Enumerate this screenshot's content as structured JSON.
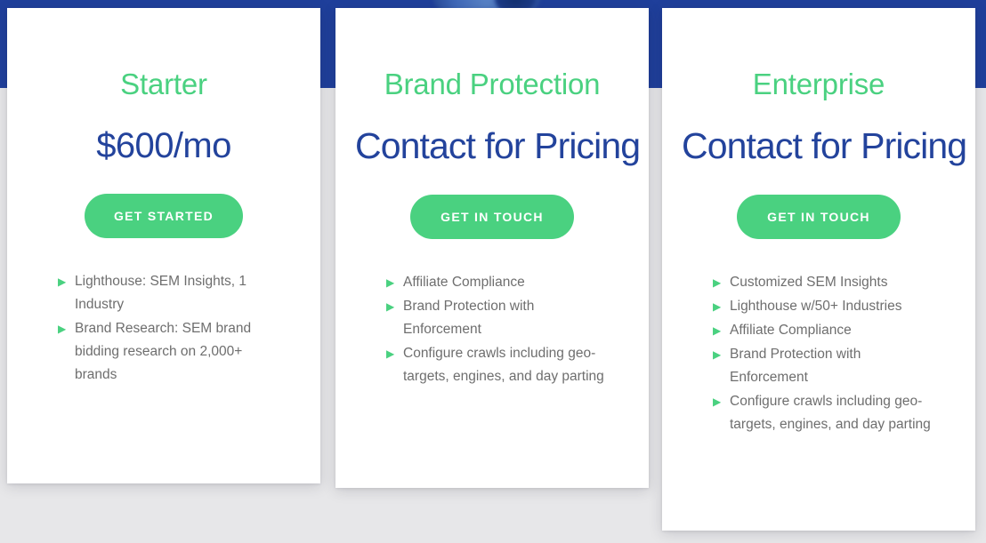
{
  "theme": {
    "band_color": "#1f3f9b",
    "page_background": "#e7e7e9",
    "card_background": "#ffffff",
    "accent_green": "#4ad180",
    "price_blue": "#23439c",
    "feature_text_color": "#6e6e6e",
    "bullet_glyph": "▶"
  },
  "plans": [
    {
      "name": "Starter",
      "price": "$600/mo",
      "cta_label": "GET STARTED",
      "features": [
        "Lighthouse: SEM Insights, 1 Industry",
        "Brand Research:  SEM brand bidding research on 2,000+ brands"
      ]
    },
    {
      "name": "Brand Protection",
      "price": "Contact for Pricing",
      "cta_label": "GET IN TOUCH",
      "features": [
        "Affiliate Compliance",
        "Brand Protection with Enforcement",
        "Configure crawls including geo-targets, engines, and day parting"
      ]
    },
    {
      "name": "Enterprise",
      "price": "Contact for Pricing",
      "cta_label": "GET IN TOUCH",
      "features": [
        "Customized SEM Insights",
        "Lighthouse w/50+ Industries",
        "Affiliate Compliance",
        "Brand Protection with Enforcement",
        "Configure crawls including geo-targets, engines, and day parting"
      ]
    }
  ]
}
